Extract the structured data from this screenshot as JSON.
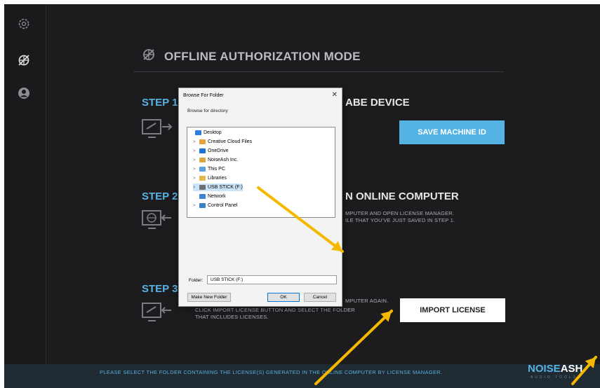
{
  "sidebar": {
    "items": [
      {
        "icon": "settings-gear-icon"
      },
      {
        "icon": "no-connection-icon"
      },
      {
        "icon": "user-account-icon"
      }
    ]
  },
  "main": {
    "title": "OFFLINE AUTHORIZATION MODE",
    "steps": [
      {
        "label": "STEP 1:",
        "heading_tail": "ABE DEVICE",
        "button": "SAVE MACHINE ID"
      },
      {
        "label": "STEP 2:",
        "heading_tail": "N ONLINE COMPUTER",
        "desc_line1": "MPUTER AND OPEN LICENSE MANAGER.",
        "desc_line2": "ILE THAT YOU'VE JUST SAVED IN STEP 1."
      },
      {
        "label": "STEP 3:",
        "desc_line1": "MPUTER AGAIN.",
        "desc_line2": "CLICK IMPORT LICENSE BUTTON AND SELECT THE FOLDER",
        "desc_line3": "THAT INCLUDES LICENSES.",
        "button": "IMPORT LICENSE"
      }
    ]
  },
  "footer": {
    "text": "PLEASE SELECT THE FOLDER CONTAINING THE LICENSE(S) GENERATED IN THE ONLINE COMPUTER BY LICENSE MANAGER.",
    "logo_a": "NOISE",
    "logo_b": "ASH",
    "logo_sub": "AUDIO TOOLS"
  },
  "dialog": {
    "title": "Browse For Folder",
    "close": "✕",
    "subtitle": "Browse for directory",
    "tree": [
      {
        "label": "Desktop",
        "chevron": "",
        "icon_color": "#2b7de0",
        "selected": false
      },
      {
        "label": "Creative Cloud Files",
        "chevron": ">",
        "icon_color": "#e8a23a",
        "selected": false
      },
      {
        "label": "OneDrive",
        "chevron": ">",
        "icon_color": "#1c73d6",
        "selected": false
      },
      {
        "label": "NoiseAsh Inc.",
        "chevron": ">",
        "icon_color": "#d9a83c",
        "selected": false
      },
      {
        "label": "This PC",
        "chevron": ">",
        "icon_color": "#5aa0e0",
        "selected": false
      },
      {
        "label": "Libraries",
        "chevron": ">",
        "icon_color": "#e2b84a",
        "selected": false
      },
      {
        "label": "USB STICK (F:)",
        "chevron": ">",
        "icon_color": "#6f6f6f",
        "selected": true
      },
      {
        "label": "Network",
        "chevron": "",
        "icon_color": "#3a86d4",
        "selected": false
      },
      {
        "label": "Control Panel",
        "chevron": ">",
        "icon_color": "#3b82c4",
        "selected": false
      }
    ],
    "folder_label": "Folder:",
    "folder_value": "USB STICK (F:)",
    "make_new_folder": "Make New Folder",
    "ok": "OK",
    "cancel": "Cancel"
  },
  "annotations": {
    "arrow_color": "#f5b800"
  }
}
